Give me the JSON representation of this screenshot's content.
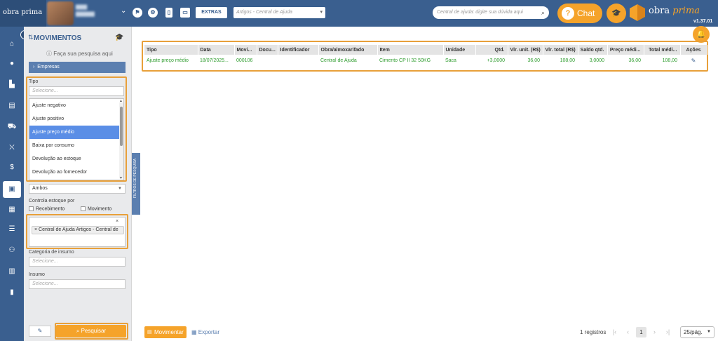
{
  "brand": {
    "logo_text": "obra prima",
    "name_main": "obra",
    "name_accent": "prima",
    "version": "v1.37.01",
    "accent_color": "#f5a32a",
    "primary_color": "#3a5f8f"
  },
  "topbar": {
    "extras_label": "EXTRAS",
    "company_placeholder": "Artigos - Central de Ajuda",
    "help_placeholder": "Central de ajuda: digite sua dúvida aqui",
    "chat_label": "Chat"
  },
  "leftnav": {
    "items": [
      "home-icon",
      "user-icon",
      "building-icon",
      "document-money-icon",
      "truck-icon",
      "cart-icon",
      "dollar-icon",
      "box-icon",
      "report-icon",
      "checklist-icon",
      "people-icon",
      "file-icon",
      "chart-icon"
    ]
  },
  "filter_panel": {
    "title": "MOVIMENTOS",
    "hint": "Faça sua pesquisa aqui",
    "empresas_label": "Empresas",
    "tipo_label": "Tipo",
    "tipo_placeholder": "Selecione...",
    "tipo_options": [
      "Ajuste negativo",
      "Ajuste positivo",
      "Ajuste preço médio",
      "Baixa por consumo",
      "Devolução ao estoque",
      "Devolução ao fornecedor"
    ],
    "tipo_selected_index": 2,
    "ambos_value": "Ambos",
    "controla_label": "Controla estoque por",
    "recebimento_label": "Recebimento",
    "movimento_label": "Movimento",
    "clear_symbol": "×",
    "obra_tag": "× Central de Ajuda Artigos - Central de",
    "categoria_label": "Categoria de insumo",
    "categoria_placeholder": "Selecione...",
    "insumo_label": "Insumo",
    "insumo_placeholder": "Selecione...",
    "search_label": "Pesquisar",
    "side_tab_label": "FILTROS DE PESQUISA"
  },
  "grid": {
    "columns": [
      "Tipo",
      "Data",
      "Movi...",
      "Docu...",
      "Identificador",
      "Obra/almoxarifado",
      "Item",
      "Unidade",
      "Qtd.",
      "Vlr. unit. (R$)",
      "Vlr. total (R$)",
      "Saldo qtd.",
      "Preço médi...",
      "Total médi...",
      "Ações"
    ],
    "rows": [
      [
        "Ajuste preço médio",
        "18/07/2025...",
        "000106",
        "",
        "",
        "Central de Ajuda",
        "Cimento CP II 32 50KG",
        "Saca",
        "+3,0000",
        "36,00",
        "108,00",
        "3,0000",
        "36,00",
        "108,00"
      ]
    ]
  },
  "footer": {
    "movimentar_label": "Movimentar",
    "exportar_label": "Exportar",
    "record_count": "1 registros",
    "current_page": "1",
    "page_size": "25/pág."
  }
}
